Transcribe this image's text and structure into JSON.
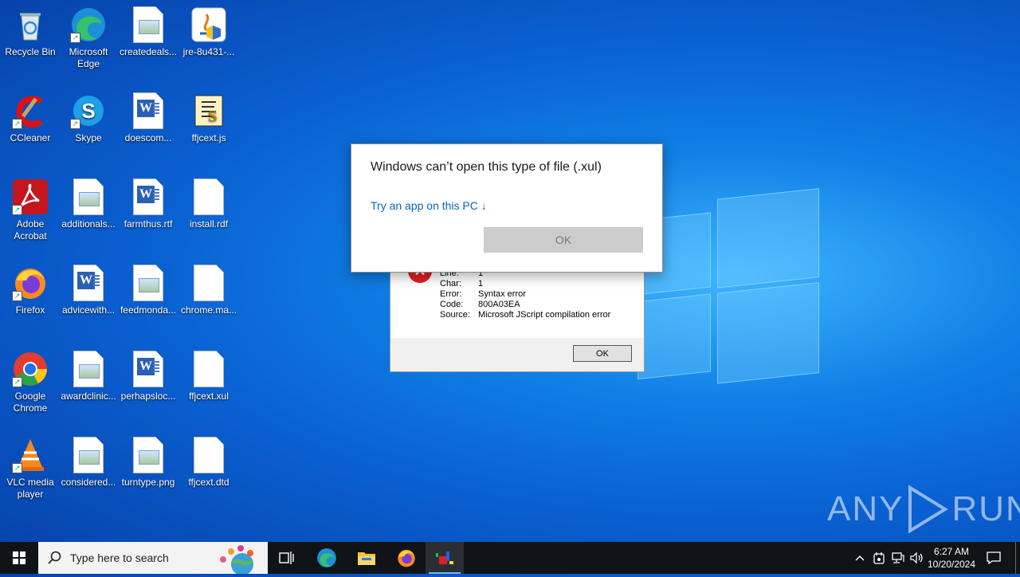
{
  "desktop_icons": [
    {
      "label": "Recycle Bin",
      "icon": "recycle-bin-icon"
    },
    {
      "label": "Microsoft Edge",
      "icon": "edge-icon"
    },
    {
      "label": "createdeals...",
      "icon": "image-file-icon"
    },
    {
      "label": "jre-8u431-...",
      "icon": "java-installer-icon"
    },
    {
      "label": "CCleaner",
      "icon": "ccleaner-icon"
    },
    {
      "label": "Skype",
      "icon": "skype-icon"
    },
    {
      "label": "doescom...",
      "icon": "word-doc-icon"
    },
    {
      "label": "ffjcext.js",
      "icon": "script-file-icon"
    },
    {
      "label": "Adobe Acrobat",
      "icon": "acrobat-icon"
    },
    {
      "label": "additionals...",
      "icon": "image-file-icon"
    },
    {
      "label": "farmthus.rtf",
      "icon": "word-doc-icon"
    },
    {
      "label": "install.rdf",
      "icon": "blank-file-icon"
    },
    {
      "label": "Firefox",
      "icon": "firefox-icon"
    },
    {
      "label": "advicewith...",
      "icon": "word-doc-icon"
    },
    {
      "label": "feedmonda...",
      "icon": "image-file-icon"
    },
    {
      "label": "chrome.ma...",
      "icon": "blank-file-icon"
    },
    {
      "label": "Google Chrome",
      "icon": "chrome-icon"
    },
    {
      "label": "awardclinic...",
      "icon": "image-file-icon"
    },
    {
      "label": "perhapsloc...",
      "icon": "word-doc-icon"
    },
    {
      "label": "ffjcext.xul",
      "icon": "blank-file-icon"
    },
    {
      "label": "VLC media player",
      "icon": "vlc-icon"
    },
    {
      "label": "considered...",
      "icon": "image-file-icon"
    },
    {
      "label": "turntype.png",
      "icon": "image-file-icon"
    },
    {
      "label": "ffjcext.dtd",
      "icon": "blank-file-icon"
    }
  ],
  "open_with_dialog": {
    "title": "Windows can’t open this type of file (.xul)",
    "link": "Try an app on this PC ↓",
    "ok_label": "OK"
  },
  "script_error_dialog": {
    "rows": [
      {
        "key": "Line:",
        "value": "1"
      },
      {
        "key": "Char:",
        "value": "1"
      },
      {
        "key": "Error:",
        "value": "Syntax error"
      },
      {
        "key": "Code:",
        "value": "800A03EA"
      },
      {
        "key": "Source:",
        "value": "Microsoft JScript compilation error"
      }
    ],
    "ok_label": "OK"
  },
  "watermark": {
    "left": "ANY",
    "right": "RUN"
  },
  "taskbar": {
    "search_placeholder": "Type here to search",
    "items": [
      "task-view-icon",
      "edge-icon",
      "file-explorer-icon",
      "firefox-icon",
      "script-host-icon"
    ],
    "clock_time": "6:27 AM",
    "clock_date": "10/20/2024"
  }
}
